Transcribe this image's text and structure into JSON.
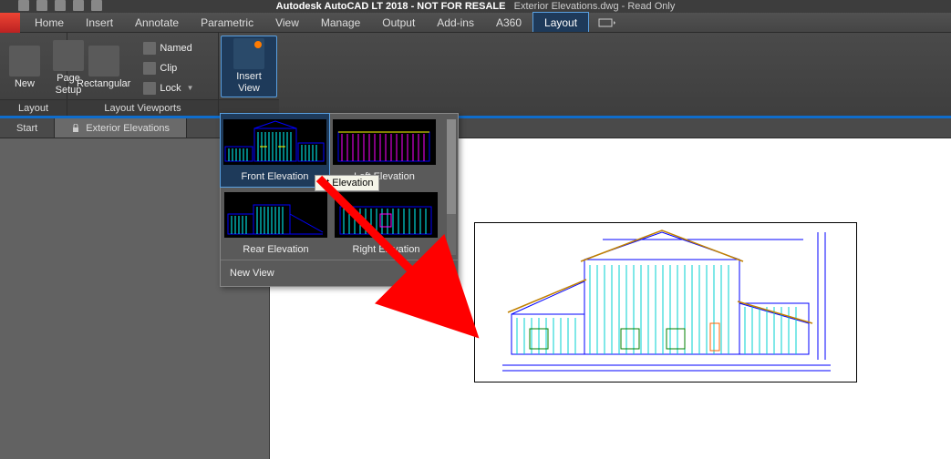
{
  "title": {
    "app": "Autodesk AutoCAD LT 2018 - NOT FOR RESALE",
    "file": "Exterior Elevations.dwg - Read Only"
  },
  "menu": {
    "items": [
      "Home",
      "Insert",
      "Annotate",
      "Parametric",
      "View",
      "Manage",
      "Output",
      "Add-ins",
      "A360",
      "Layout"
    ],
    "active": "Layout"
  },
  "ribbon": {
    "panels": [
      {
        "title": "Layout",
        "big": [
          {
            "label": "New"
          },
          {
            "label": "Page\nSetup"
          }
        ]
      },
      {
        "title": "Layout Viewports",
        "big": [
          {
            "label": "Rectangular"
          }
        ],
        "small": [
          {
            "label": "Named"
          },
          {
            "label": "Clip"
          },
          {
            "label": "Lock",
            "dd": true
          }
        ]
      },
      {
        "title": "",
        "big": [
          {
            "label": "Insert View",
            "active": true,
            "dot": true
          }
        ]
      }
    ]
  },
  "filetabs": {
    "items": [
      {
        "label": "Start"
      },
      {
        "label": "Exterior Elevations",
        "locked": true,
        "active": true
      }
    ]
  },
  "gallery": {
    "items": [
      {
        "label": "Front Elevation",
        "sel": true
      },
      {
        "label": "Left Elevation"
      },
      {
        "label": "Rear Elevation"
      },
      {
        "label": "Right Elevation"
      }
    ],
    "tooltip": "nt Elevation",
    "new": "New View"
  }
}
